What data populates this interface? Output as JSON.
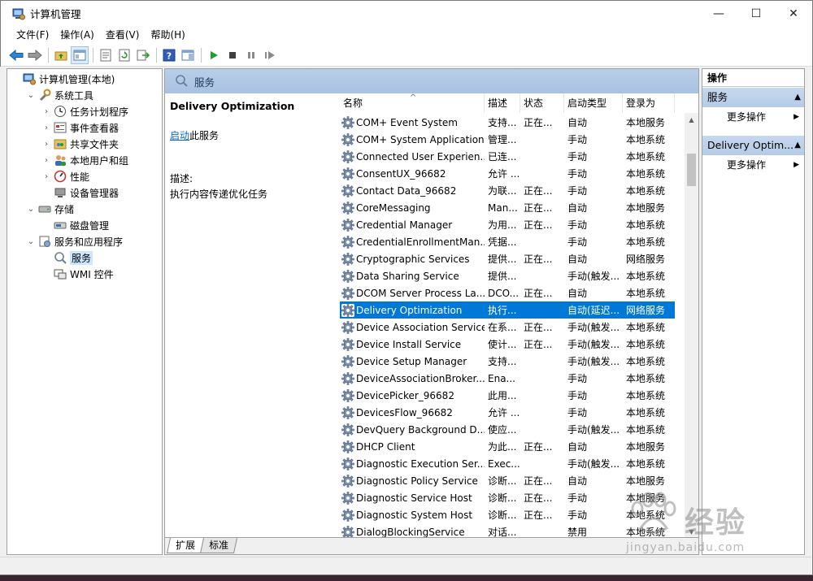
{
  "window": {
    "title": "计算机管理",
    "minimize": "—",
    "maximize": "☐",
    "close": "✕"
  },
  "menu": [
    "文件(F)",
    "操作(A)",
    "查看(V)",
    "帮助(H)"
  ],
  "tree": [
    {
      "label": "计算机管理(本地)",
      "level": 0,
      "expander": "",
      "icon": "computer-management-icon"
    },
    {
      "label": "系统工具",
      "level": 1,
      "expander": "⌄",
      "icon": "system-tools-icon"
    },
    {
      "label": "任务计划程序",
      "level": 2,
      "expander": "›",
      "icon": "task-scheduler-icon"
    },
    {
      "label": "事件查看器",
      "level": 2,
      "expander": "›",
      "icon": "event-viewer-icon"
    },
    {
      "label": "共享文件夹",
      "level": 2,
      "expander": "›",
      "icon": "shared-folders-icon"
    },
    {
      "label": "本地用户和组",
      "level": 2,
      "expander": "›",
      "icon": "local-users-icon"
    },
    {
      "label": "性能",
      "level": 2,
      "expander": "›",
      "icon": "performance-icon"
    },
    {
      "label": "设备管理器",
      "level": 2,
      "expander": "",
      "icon": "device-manager-icon"
    },
    {
      "label": "存储",
      "level": 1,
      "expander": "⌄",
      "icon": "storage-icon"
    },
    {
      "label": "磁盘管理",
      "level": 2,
      "expander": "",
      "icon": "disk-management-icon"
    },
    {
      "label": "服务和应用程序",
      "level": 1,
      "expander": "⌄",
      "icon": "services-apps-icon"
    },
    {
      "label": "服务",
      "level": 2,
      "expander": "",
      "icon": "services-icon",
      "selected": true
    },
    {
      "label": "WMI 控件",
      "level": 2,
      "expander": "",
      "icon": "wmi-control-icon"
    }
  ],
  "center": {
    "header": "服务",
    "detail": {
      "title": "Delivery Optimization",
      "start_link": "启动",
      "start_suffix": "此服务",
      "desc_label": "描述:",
      "desc_text": "执行内容传递优化任务"
    },
    "columns": [
      "名称",
      "描述",
      "状态",
      "启动类型",
      "登录为"
    ],
    "rows": [
      [
        "COM+ Event System",
        "支持...",
        "正在...",
        "自动",
        "本地服务"
      ],
      [
        "COM+ System Application",
        "管理...",
        "",
        "手动",
        "本地系统"
      ],
      [
        "Connected User Experien...",
        "已连...",
        "",
        "手动",
        "本地系统"
      ],
      [
        "ConsentUX_96682",
        "允许 ...",
        "",
        "手动",
        "本地系统"
      ],
      [
        "Contact Data_96682",
        "为联...",
        "正在...",
        "手动",
        "本地系统"
      ],
      [
        "CoreMessaging",
        "Man...",
        "正在...",
        "自动",
        "本地服务"
      ],
      [
        "Credential Manager",
        "为用...",
        "正在...",
        "手动",
        "本地系统"
      ],
      [
        "CredentialEnrollmentMan...",
        "凭据...",
        "",
        "手动",
        "本地系统"
      ],
      [
        "Cryptographic Services",
        "提供...",
        "正在...",
        "自动",
        "网络服务"
      ],
      [
        "Data Sharing Service",
        "提供...",
        "",
        "手动(触发...",
        "本地系统"
      ],
      [
        "DCOM Server Process La...",
        "DCO...",
        "正在...",
        "自动",
        "本地系统"
      ],
      [
        "Delivery Optimization",
        "执行...",
        "",
        "自动(延迟...",
        "网络服务"
      ],
      [
        "Device Association Service",
        "在系...",
        "正在...",
        "手动(触发...",
        "本地系统"
      ],
      [
        "Device Install Service",
        "使计...",
        "正在...",
        "手动(触发...",
        "本地系统"
      ],
      [
        "Device Setup Manager",
        "支持...",
        "",
        "手动(触发...",
        "本地系统"
      ],
      [
        "DeviceAssociationBroker...",
        "Ena...",
        "",
        "手动",
        "本地系统"
      ],
      [
        "DevicePicker_96682",
        "此用...",
        "",
        "手动",
        "本地系统"
      ],
      [
        "DevicesFlow_96682",
        "允许 ...",
        "",
        "手动",
        "本地系统"
      ],
      [
        "DevQuery Background D...",
        "使应...",
        "",
        "手动(触发...",
        "本地系统"
      ],
      [
        "DHCP Client",
        "为此...",
        "正在...",
        "自动",
        "本地服务"
      ],
      [
        "Diagnostic Execution Ser...",
        "Exec...",
        "",
        "手动(触发...",
        "本地系统"
      ],
      [
        "Diagnostic Policy Service",
        "诊断...",
        "正在...",
        "自动",
        "本地服务"
      ],
      [
        "Diagnostic Service Host",
        "诊断...",
        "正在...",
        "手动",
        "本地服务"
      ],
      [
        "Diagnostic System Host",
        "诊断...",
        "正在...",
        "手动",
        "本地系统"
      ],
      [
        "DialogBlockingService",
        "对话...",
        "",
        "禁用",
        "本地系统"
      ]
    ],
    "selected_row": 11,
    "tabs": [
      "扩展",
      "标准"
    ],
    "sort_indicator": "^"
  },
  "actions": {
    "header": "操作",
    "groups": [
      {
        "title": "服务",
        "items": [
          "更多操作"
        ]
      },
      {
        "title": "Delivery Optim...",
        "items": [
          "更多操作"
        ]
      }
    ]
  },
  "watermark": {
    "text": "经验",
    "sub": "jingyan.baidu.com"
  },
  "colors": {
    "selection": "#0078d7",
    "link": "#0b66c2",
    "header_band": "#b8cee8"
  }
}
